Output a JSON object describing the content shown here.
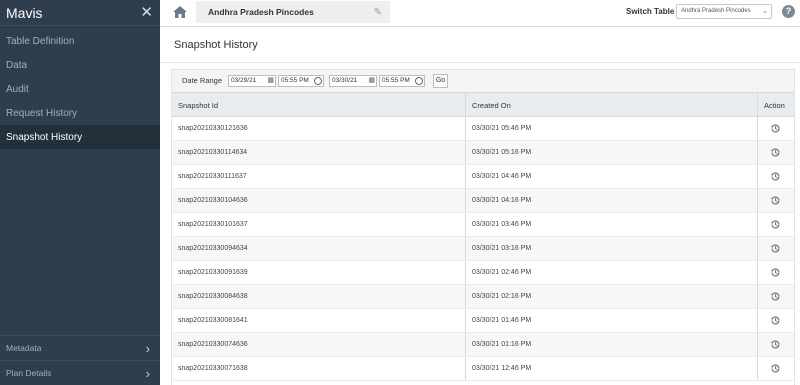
{
  "sidebar": {
    "title": "Mavis",
    "items": [
      {
        "label": "Table Definition",
        "active": false
      },
      {
        "label": "Data",
        "active": false
      },
      {
        "label": "Audit",
        "active": false
      },
      {
        "label": "Request History",
        "active": false
      },
      {
        "label": "Snapshot History",
        "active": true
      }
    ],
    "bottom_items": [
      {
        "label": "Metadata"
      },
      {
        "label": "Plan Details"
      }
    ]
  },
  "topbar": {
    "table_name": "Andhra Pradesh Pincodes",
    "switch_label": "Switch Table",
    "switch_value": "Andhra Pradesh Pincodes"
  },
  "page": {
    "title": "Snapshot History"
  },
  "filter": {
    "label": "Date Range",
    "from_date": "03/29/21",
    "from_time": "05:55 PM",
    "to_date": "03/30/21",
    "to_time": "05:55 PM",
    "go_label": "Go"
  },
  "table": {
    "columns": [
      "Snapshot Id",
      "Created On",
      "Action"
    ],
    "rows": [
      {
        "id": "snap20210330121636",
        "created": "03/30/21 05:46 PM"
      },
      {
        "id": "snap20210330114634",
        "created": "03/30/21 05:16 PM"
      },
      {
        "id": "snap20210330111637",
        "created": "03/30/21 04:46 PM"
      },
      {
        "id": "snap20210330104636",
        "created": "03/30/21 04:16 PM"
      },
      {
        "id": "snap20210330101637",
        "created": "03/30/21 03:46 PM"
      },
      {
        "id": "snap20210330094634",
        "created": "03/30/21 03:16 PM"
      },
      {
        "id": "snap20210330091639",
        "created": "03/30/21 02:46 PM"
      },
      {
        "id": "snap20210330084638",
        "created": "03/30/21 02:16 PM"
      },
      {
        "id": "snap20210330081641",
        "created": "03/30/21 01:46 PM"
      },
      {
        "id": "snap20210330074636",
        "created": "03/30/21 01:16 PM"
      },
      {
        "id": "snap20210330071638",
        "created": "03/30/21 12:46 PM"
      }
    ]
  },
  "icons": {
    "home": "home-icon",
    "edit": "pencil-icon",
    "help": "help-icon",
    "restore": "restore-icon",
    "calendar": "calendar-icon",
    "clock": "clock-icon"
  },
  "colors": {
    "sidebar_bg": "#2e3e4c",
    "sidebar_active_bg": "#23303b",
    "header_bg": "#e9ecef"
  }
}
